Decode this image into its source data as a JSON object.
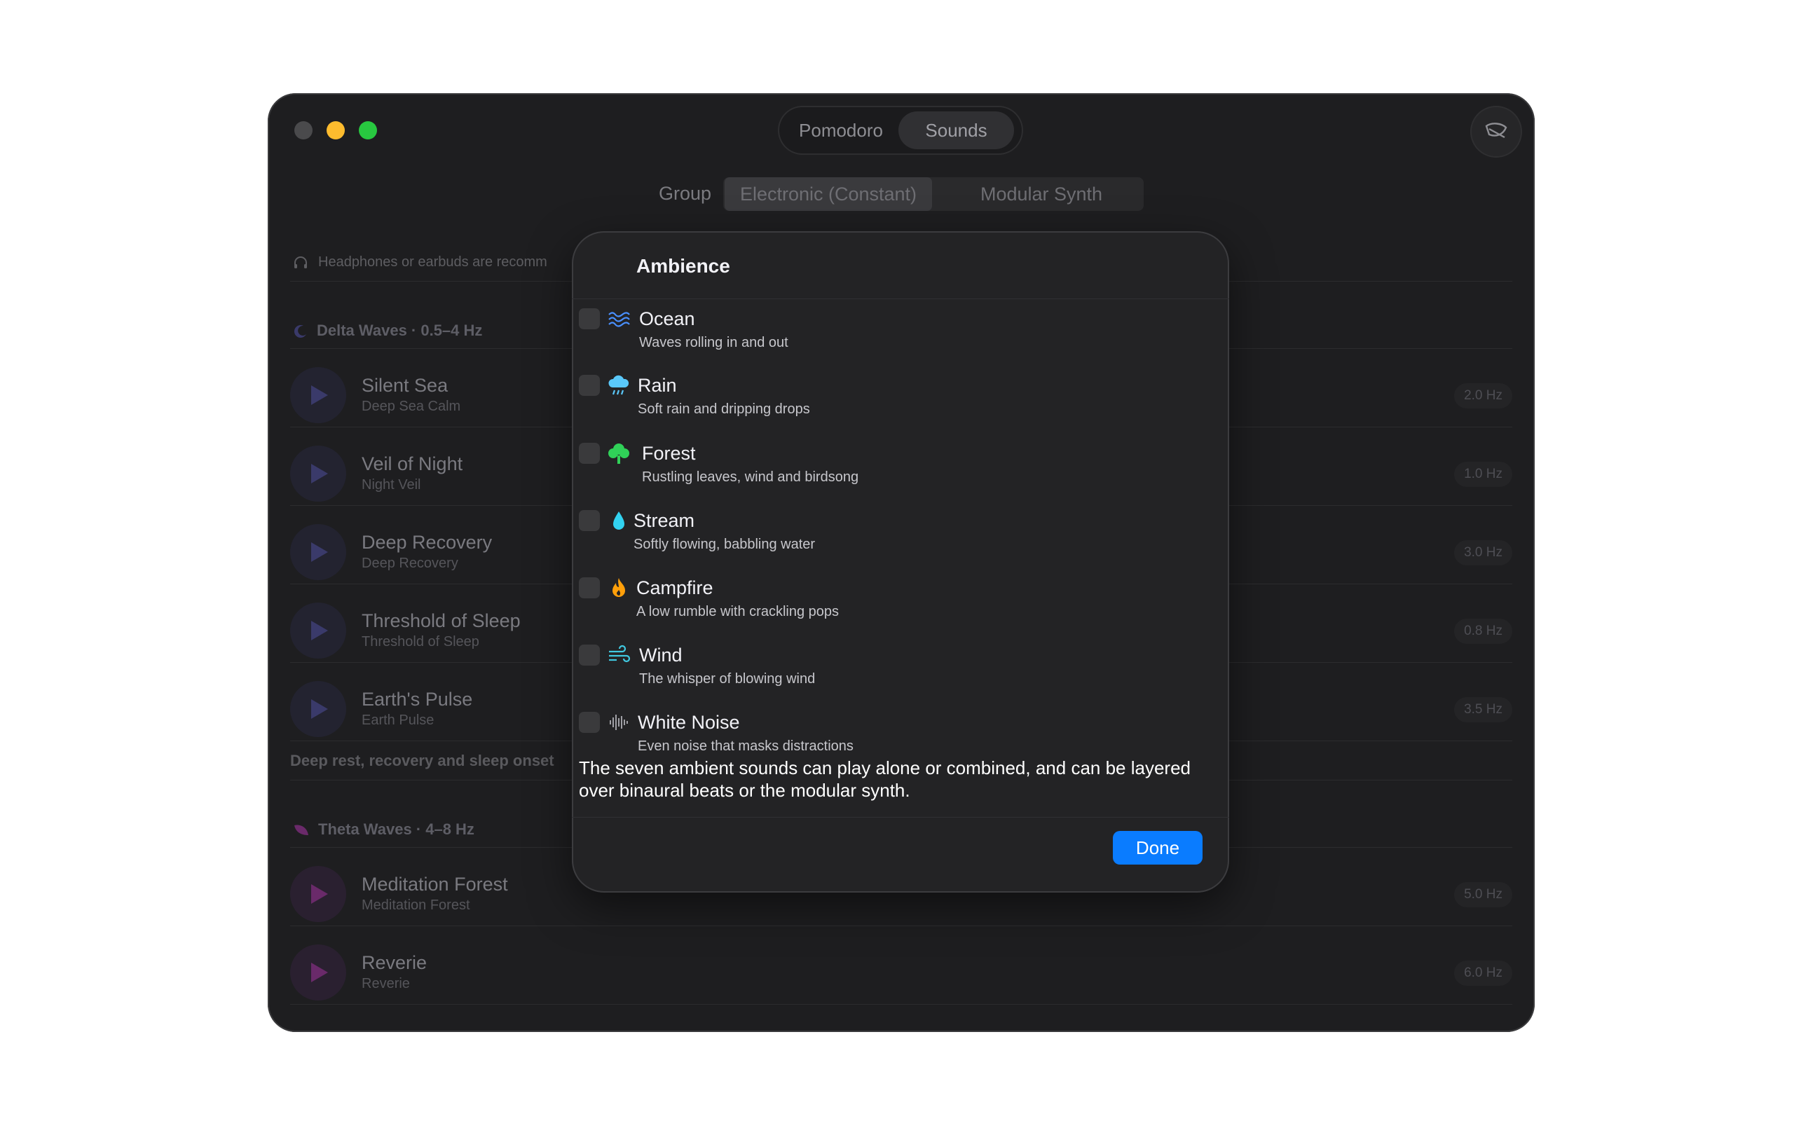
{
  "top_tabs": [
    "Pomodoro",
    "Sounds"
  ],
  "group": {
    "label": "Group",
    "options": [
      "Electronic (Constant)",
      "Modular Synth"
    ]
  },
  "hint": "Headphones or earbuds are recomm",
  "delta": {
    "heading": "Delta Waves · 0.5–4 Hz",
    "rows": [
      {
        "title": "Silent Sea",
        "sub": "Deep Sea Calm",
        "hz": "2.0 Hz"
      },
      {
        "title": "Veil of Night",
        "sub": "Night Veil",
        "hz": "1.0 Hz"
      },
      {
        "title": "Deep Recovery",
        "sub": "Deep Recovery",
        "hz": "3.0 Hz"
      },
      {
        "title": "Threshold of Sleep",
        "sub": "Threshold of Sleep",
        "hz": "0.8 Hz"
      },
      {
        "title": "Earth's Pulse",
        "sub": "Earth Pulse",
        "hz": "3.5 Hz"
      }
    ],
    "footer": "Deep rest, recovery and sleep onset"
  },
  "theta": {
    "heading": "Theta Waves · 4–8 Hz",
    "rows": [
      {
        "title": "Meditation Forest",
        "sub": "Meditation Forest",
        "hz": "5.0 Hz"
      },
      {
        "title": "Reverie",
        "sub": "Reverie",
        "hz": "6.0 Hz"
      }
    ]
  },
  "dialog": {
    "title": "Ambience",
    "items": [
      {
        "title": "Ocean",
        "sub": "Waves rolling in and out",
        "icon": "waves-icon",
        "color": "#4a90ff"
      },
      {
        "title": "Rain",
        "sub": "Soft rain and dripping drops",
        "icon": "cloud-rain-icon",
        "color": "#5ac8fa"
      },
      {
        "title": "Forest",
        "sub": "Rustling leaves, wind and birdsong",
        "icon": "tree-icon",
        "color": "#30d158"
      },
      {
        "title": "Stream",
        "sub": "Softly flowing, babbling water",
        "icon": "drop-icon",
        "color": "#32d2f0"
      },
      {
        "title": "Campfire",
        "sub": "A low rumble with crackling pops",
        "icon": "flame-icon",
        "color": "#ff9f0a"
      },
      {
        "title": "Wind",
        "sub": "The whisper of blowing wind",
        "icon": "wind-icon",
        "color": "#40c8e0"
      },
      {
        "title": "White Noise",
        "sub": "Even noise that masks distractions",
        "icon": "waveform-icon",
        "color": "#a0a0a6"
      }
    ],
    "note": "The seven ambient sounds can play alone or combined, and can be layered over binaural beats or the modular synth.",
    "done": "Done"
  },
  "colors": {
    "accent": "#0a7cff",
    "delta": "#3a3a6a",
    "theta": "#6a2a6a"
  }
}
